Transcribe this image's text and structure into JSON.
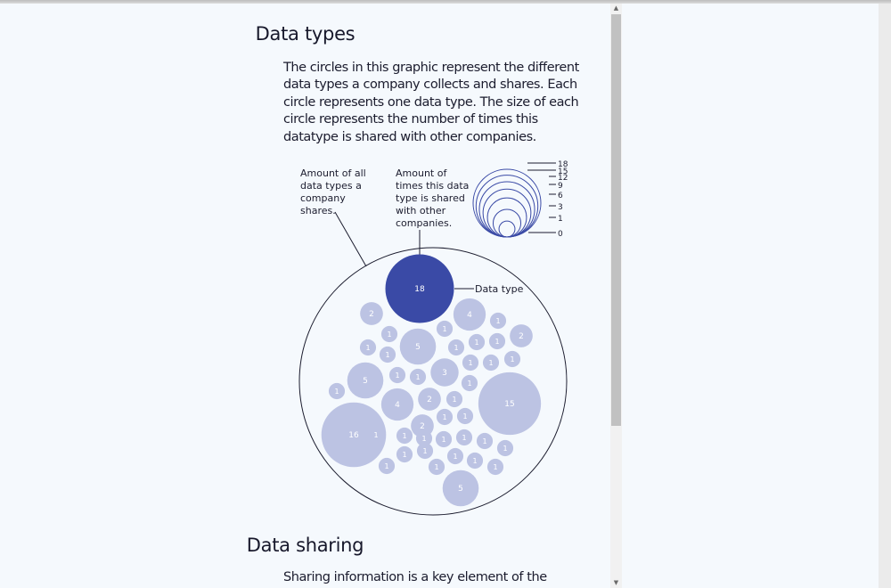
{
  "sections": {
    "data_types": {
      "title": "Data types",
      "intro": "The circles in this graphic represent the different data types a company collects and shares. Each circle represents one data type. The size of each circle represents the number of times this datatype is shared with other companies."
    },
    "data_sharing": {
      "title": "Data sharing",
      "intro": "Sharing information is a key element of the"
    }
  },
  "annotations": {
    "all_types_label": [
      "Amount of all",
      "data types a",
      "company",
      "shares."
    ],
    "times_shared_label": [
      "Amount of",
      "times this data",
      "type is shared",
      "with other",
      "companies."
    ],
    "data_type_label": "Data type"
  },
  "legend": {
    "values": [
      "18",
      "15",
      "12",
      "9",
      "6",
      "3",
      "1",
      "0"
    ]
  },
  "colors": {
    "highlight": "#3a4aa6",
    "bubble": "#bcc3e3",
    "legend_stroke": "#3a4aa6",
    "outline": "#1b1c2e",
    "background": "#f5f9fd"
  },
  "chart_data": {
    "type": "bubble",
    "values": [
      18,
      16,
      15,
      5,
      5,
      5,
      4,
      4,
      3,
      2,
      2,
      2,
      2,
      1,
      1,
      1,
      1,
      1,
      1,
      1,
      1,
      1,
      1,
      1,
      1,
      1,
      1,
      1,
      1,
      1,
      1,
      1,
      1,
      1,
      1,
      1,
      1,
      1,
      1,
      1,
      1,
      1,
      1,
      1,
      1
    ]
  }
}
